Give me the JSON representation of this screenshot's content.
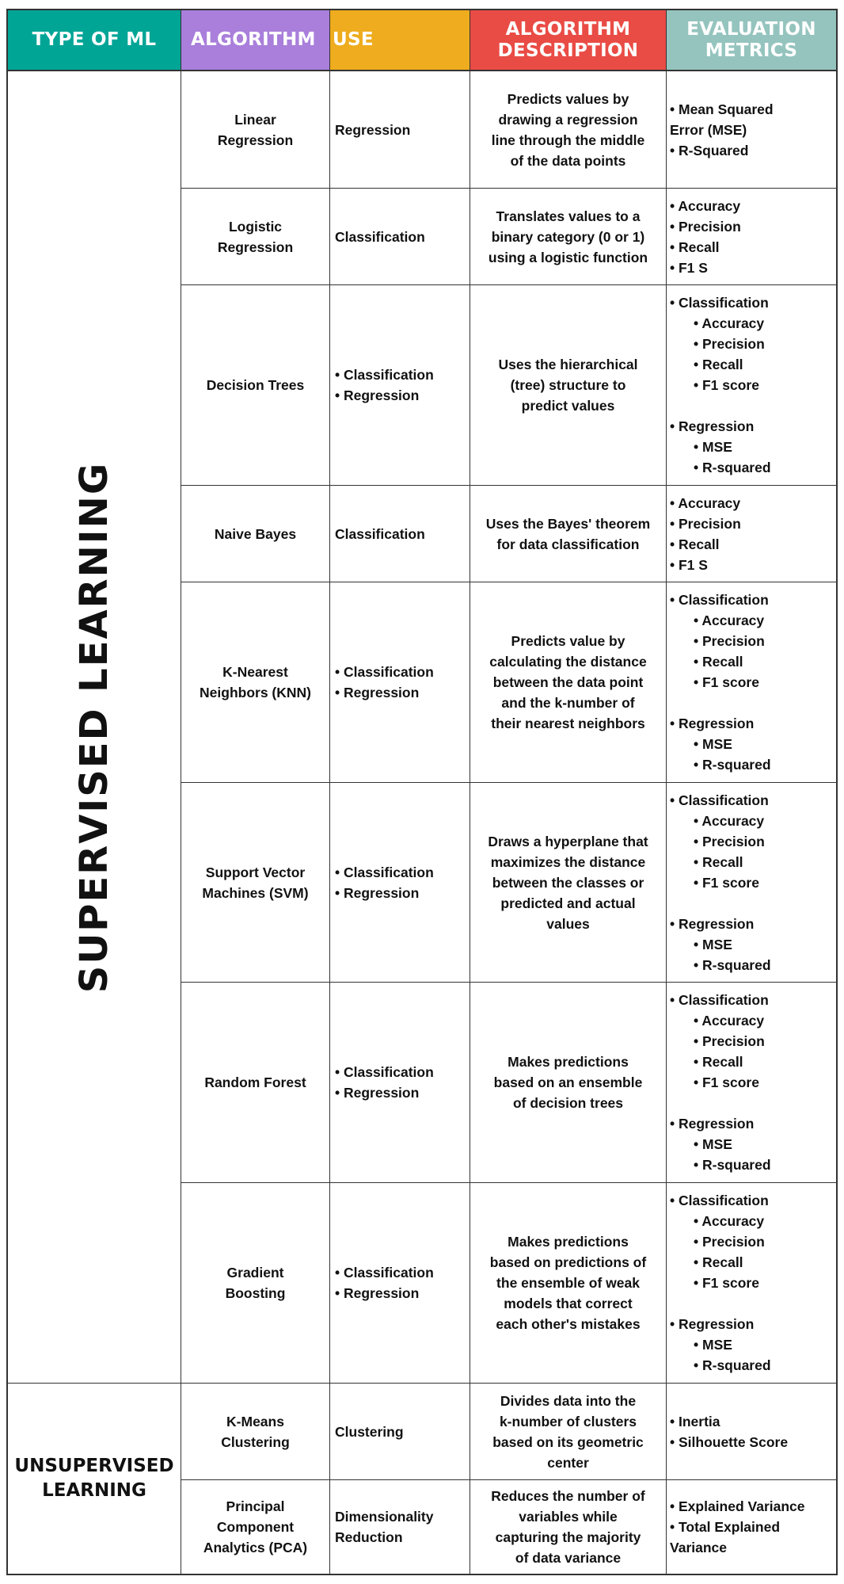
{
  "header": {
    "type_of_ml": "TYPE OF ML",
    "algorithm": "ALGORITHM",
    "use": "USE",
    "description_line1": "ALGORITHM",
    "description_line2": "DESCRIPTION",
    "metrics_line1": "EVALUATION",
    "metrics_line2": "METRICS"
  },
  "colors": {
    "type_of_ml": "#00A596",
    "algorithm": "#A97FDB",
    "use": "#EEAC1E",
    "description": "#E94C45",
    "metrics": "#95C4BE"
  },
  "groups": {
    "supervised": "SUPERVISED LEARNING",
    "unsupervised_line1": "UNSUPERVISED",
    "unsupervised_line2": "LEARNING"
  },
  "rows": [
    {
      "algorithm": [
        "Linear",
        "Regression"
      ],
      "use": [
        "Regression"
      ],
      "use_bulleted": false,
      "description": [
        "Predicts values by",
        "drawing a regression",
        "line through the middle",
        "of the data points"
      ],
      "metrics": [
        [
          "• Mean Squared",
          0
        ],
        [
          "Error (MSE)",
          0
        ],
        [
          "• R-Squared",
          0
        ]
      ]
    },
    {
      "algorithm": [
        "Logistic",
        "Regression"
      ],
      "use": [
        "Classification"
      ],
      "use_bulleted": false,
      "description": [
        "Translates values to a",
        "binary category (0 or 1)",
        "using a logistic function"
      ],
      "metrics": [
        [
          "• Accuracy",
          0
        ],
        [
          "• Precision",
          0
        ],
        [
          "• Recall",
          0
        ],
        [
          "• F1 S",
          0
        ]
      ]
    },
    {
      "algorithm": [
        "Decision Trees"
      ],
      "use": [
        "• Classification",
        "• Regression"
      ],
      "use_bulleted": true,
      "description": [
        "Uses the hierarchical",
        "(tree) structure to",
        "predict values"
      ],
      "metrics": [
        [
          "• Classification",
          0
        ],
        [
          "• Accuracy",
          1
        ],
        [
          "• Precision",
          1
        ],
        [
          "• Recall",
          1
        ],
        [
          "• F1 score",
          1
        ],
        [
          "",
          2
        ],
        [
          "• Regression",
          0
        ],
        [
          "• MSE",
          1
        ],
        [
          "• R-squared",
          1
        ]
      ]
    },
    {
      "algorithm": [
        "Naive Bayes"
      ],
      "use": [
        "Classification"
      ],
      "use_bulleted": false,
      "description": [
        "Uses the Bayes' theorem",
        "for data classification"
      ],
      "metrics": [
        [
          "• Accuracy",
          0
        ],
        [
          "• Precision",
          0
        ],
        [
          "• Recall",
          0
        ],
        [
          "• F1 S",
          0
        ]
      ]
    },
    {
      "algorithm": [
        "K-Nearest",
        "Neighbors (KNN)"
      ],
      "use": [
        "• Classification",
        "• Regression"
      ],
      "use_bulleted": true,
      "description": [
        "Predicts value by",
        "calculating the distance",
        "between the data point",
        "and the k-number of",
        "their nearest neighbors"
      ],
      "metrics": [
        [
          "• Classification",
          0
        ],
        [
          "• Accuracy",
          1
        ],
        [
          "• Precision",
          1
        ],
        [
          "• Recall",
          1
        ],
        [
          "• F1 score",
          1
        ],
        [
          "",
          2
        ],
        [
          "• Regression",
          0
        ],
        [
          "• MSE",
          1
        ],
        [
          "• R-squared",
          1
        ]
      ]
    },
    {
      "algorithm": [
        "Support Vector",
        "Machines (SVM)"
      ],
      "use": [
        "• Classification",
        "• Regression"
      ],
      "use_bulleted": true,
      "description": [
        "Draws a hyperplane that",
        "maximizes the distance",
        "between the classes or",
        "predicted and actual",
        "values"
      ],
      "metrics": [
        [
          "• Classification",
          0
        ],
        [
          "• Accuracy",
          1
        ],
        [
          "• Precision",
          1
        ],
        [
          "• Recall",
          1
        ],
        [
          "• F1 score",
          1
        ],
        [
          "",
          2
        ],
        [
          "• Regression",
          0
        ],
        [
          "• MSE",
          1
        ],
        [
          "• R-squared",
          1
        ]
      ]
    },
    {
      "algorithm": [
        "Random Forest"
      ],
      "use": [
        "• Classification",
        "• Regression"
      ],
      "use_bulleted": true,
      "description": [
        "Makes predictions",
        "based on an ensemble",
        "of decision trees"
      ],
      "metrics": [
        [
          "• Classification",
          0
        ],
        [
          "• Accuracy",
          1
        ],
        [
          "• Precision",
          1
        ],
        [
          "• Recall",
          1
        ],
        [
          "• F1 score",
          1
        ],
        [
          "",
          2
        ],
        [
          "• Regression",
          0
        ],
        [
          "• MSE",
          1
        ],
        [
          "• R-squared",
          1
        ]
      ]
    },
    {
      "algorithm": [
        "Gradient",
        "Boosting"
      ],
      "use": [
        "• Classification",
        "• Regression"
      ],
      "use_bulleted": true,
      "description": [
        "Makes predictions",
        "based on predictions of",
        "the ensemble of weak",
        "models that correct",
        "each other's mistakes"
      ],
      "metrics": [
        [
          "• Classification",
          0
        ],
        [
          "• Accuracy",
          1
        ],
        [
          "• Precision",
          1
        ],
        [
          "• Recall",
          1
        ],
        [
          "• F1 score",
          1
        ],
        [
          "",
          2
        ],
        [
          "• Regression",
          0
        ],
        [
          "• MSE",
          1
        ],
        [
          "• R-squared",
          1
        ]
      ]
    },
    {
      "algorithm": [
        "K-Means",
        "Clustering"
      ],
      "use": [
        "Clustering"
      ],
      "use_bulleted": false,
      "description": [
        "Divides data into the",
        "k-number of clusters",
        "based on its geometric",
        "center"
      ],
      "metrics": [
        [
          "• Inertia",
          0
        ],
        [
          "• Silhouette Score",
          0
        ]
      ]
    },
    {
      "algorithm": [
        "Principal",
        "Component",
        "Analytics (PCA)"
      ],
      "use": [
        "Dimensionality",
        "Reduction"
      ],
      "use_bulleted": false,
      "description": [
        "Reduces the number of",
        "variables while",
        "capturing the majority",
        "of data variance"
      ],
      "metrics": [
        [
          "• Explained Variance",
          0
        ],
        [
          "• Total Explained",
          0
        ],
        [
          "Variance",
          0
        ]
      ]
    }
  ]
}
